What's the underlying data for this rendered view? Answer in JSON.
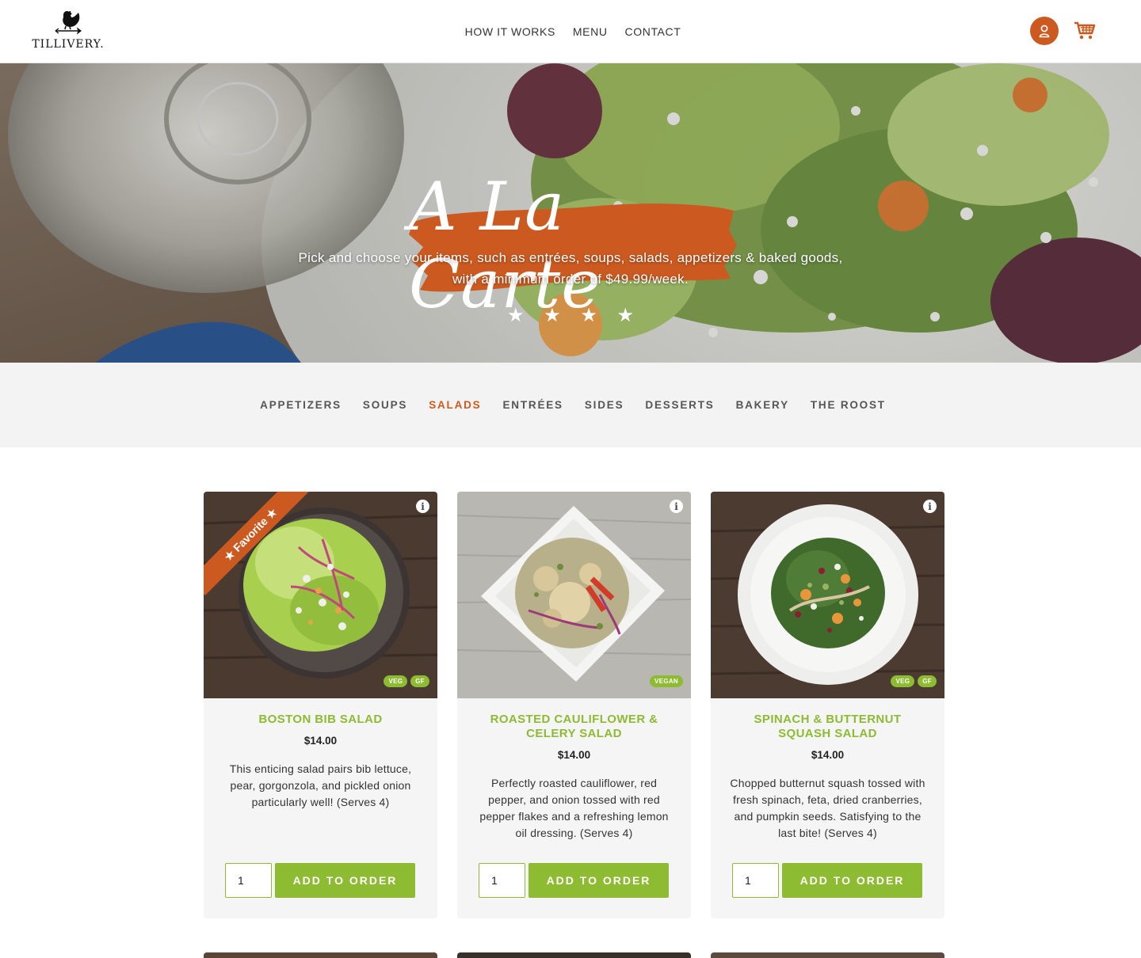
{
  "brand": {
    "name": "TILLIVERY."
  },
  "nav": {
    "items": [
      "HOW IT WORKS",
      "MENU",
      "CONTACT"
    ]
  },
  "header_icons": {
    "account": "user-icon",
    "cart": "shopping-cart-icon"
  },
  "hero": {
    "title": "A La Carte",
    "subtitle": "Pick and choose your items, such as entrées, soups, salads, appetizers & baked goods, with a minimum order of $49.99/week.",
    "stars": [
      "★",
      "★",
      "★",
      "★"
    ]
  },
  "categories": {
    "items": [
      "APPETIZERS",
      "SOUPS",
      "SALADS",
      "ENTRÉES",
      "SIDES",
      "DESSERTS",
      "BAKERY",
      "THE ROOST"
    ],
    "active": "SALADS"
  },
  "products": [
    {
      "title": "BOSTON BIB SALAD",
      "price": "$14.00",
      "description": "This enticing salad pairs bib lettuce, pear, gorgonzola, and pickled onion particularly well! (Serves 4)",
      "badges": [
        "VEG",
        "GF"
      ],
      "ribbon": "★ Favorite ★",
      "quantity": "1",
      "button": "ADD TO ORDER"
    },
    {
      "title": "ROASTED CAULIFLOWER & CELERY SALAD",
      "price": "$14.00",
      "description": "Perfectly roasted cauliflower, red pepper, and onion tossed with red pepper flakes and a refreshing lemon oil dressing. (Serves 4)",
      "badges": [
        "VEGAN"
      ],
      "quantity": "1",
      "button": "ADD TO ORDER"
    },
    {
      "title": "SPINACH & BUTTERNUT SQUASH SALAD",
      "price": "$14.00",
      "description": "Chopped butternut squash tossed with fresh spinach, feta, dried cranberries, and pumpkin seeds. Satisfying to the last bite! (Serves 4)",
      "badges": [
        "VEG",
        "GF"
      ],
      "quantity": "1",
      "button": "ADD TO ORDER"
    }
  ],
  "colors": {
    "accent_orange": "#cc5a20",
    "accent_green": "#8dbb32",
    "category_bg": "#f3f3f3",
    "card_bg": "#f5f5f5"
  }
}
